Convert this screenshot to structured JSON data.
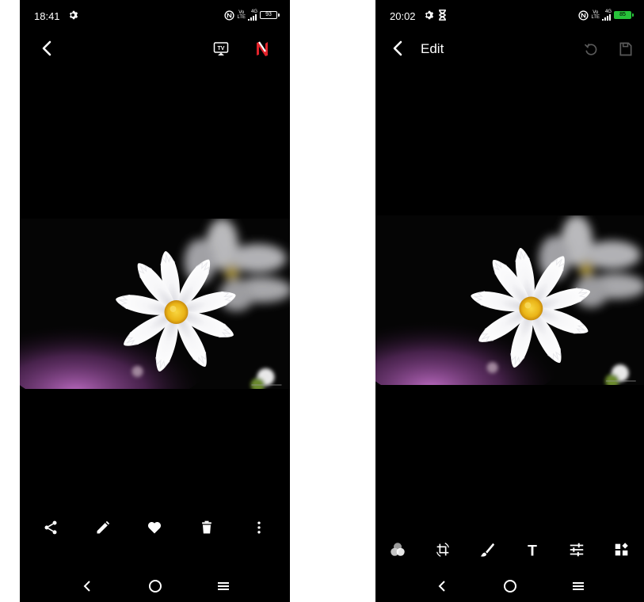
{
  "left_screen": {
    "status": {
      "time": "18:41",
      "battery": "93",
      "network_label": "LTE",
      "vo_label": "Vo",
      "sig_label": "4G"
    },
    "appbar": {
      "icons": [
        "back-arrow-icon",
        "cast-tv-icon",
        "n-app-icon"
      ],
      "tv_label": "TV"
    },
    "toolbar": [
      "share-icon",
      "pencil-icon",
      "heart-icon",
      "trash-icon",
      "more-vert-icon"
    ],
    "navbar": [
      "nav-back-icon",
      "nav-home-icon",
      "nav-menu-icon"
    ]
  },
  "right_screen": {
    "status": {
      "time": "20:02",
      "battery": "85",
      "network_label": "LTE",
      "vo_label": "Vo",
      "sig_label": "4G"
    },
    "appbar": {
      "title": "Edit",
      "icons": [
        "back-arrow-icon",
        "reset-icon",
        "save-icon"
      ]
    },
    "toolbar": [
      "filter-icon",
      "crop-rotate-icon",
      "brush-icon",
      "text-icon",
      "adjust-icon",
      "more-tools-icon"
    ],
    "text_tool_label": "T",
    "navbar": [
      "nav-back-icon",
      "nav-home-icon",
      "nav-menu-icon"
    ]
  },
  "colors": {
    "background": "#000000",
    "accent_n_logo": "#e1232b",
    "battery_charging": "#27c23a",
    "petal": "#f4f4f6",
    "flower_center": "#f2c01b",
    "pink_bokeh": "#b463b8"
  }
}
